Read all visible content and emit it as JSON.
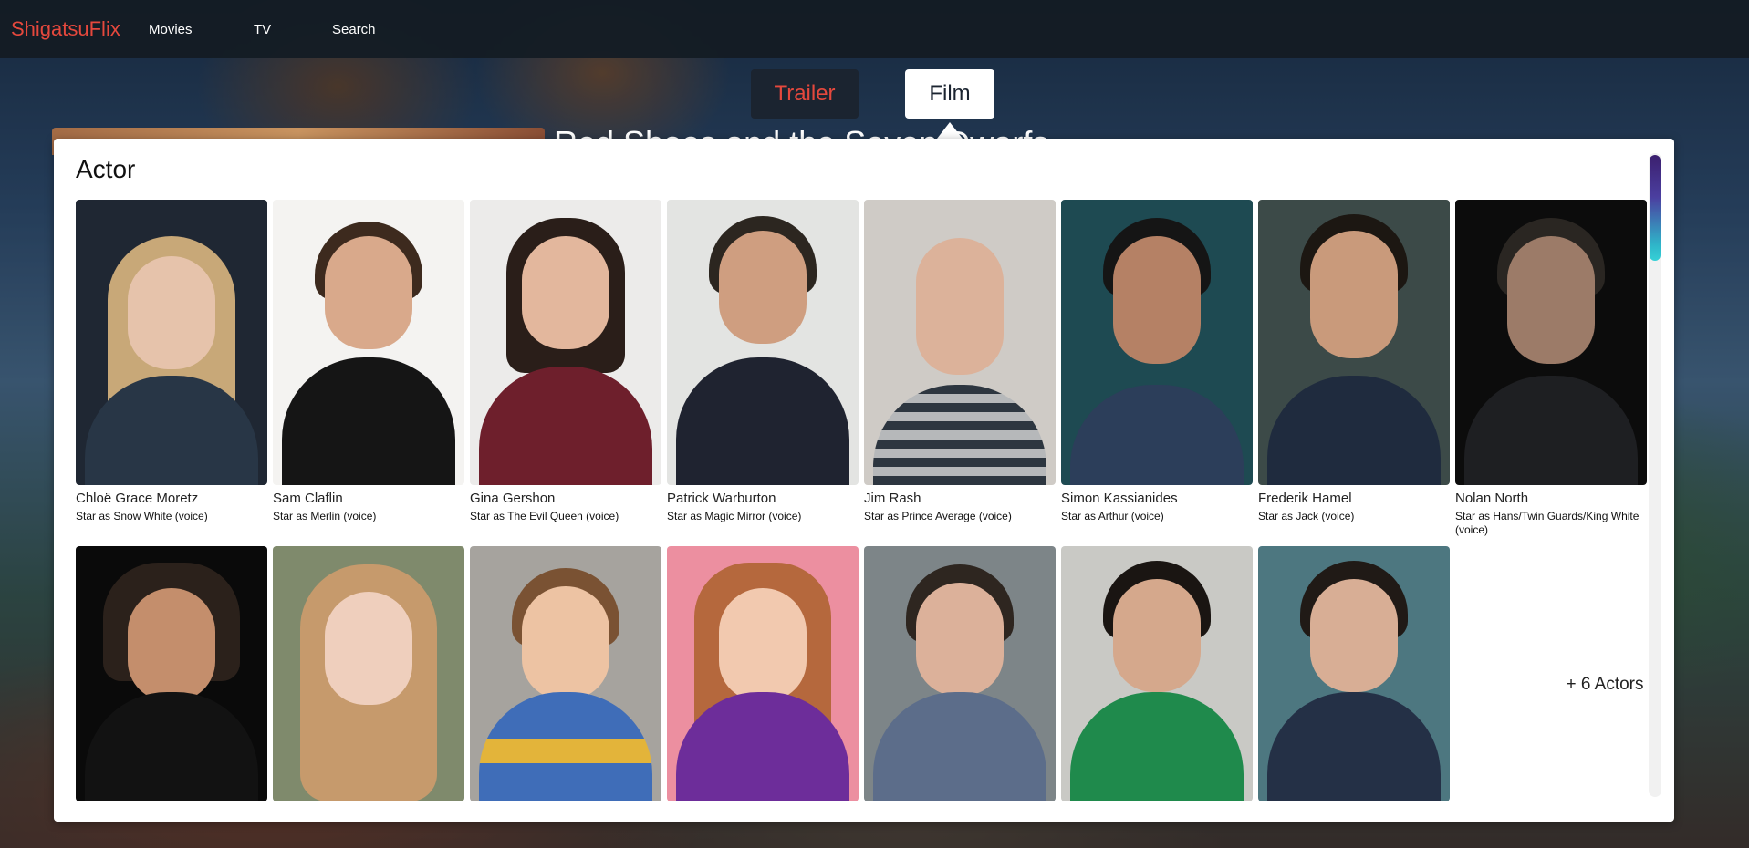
{
  "brand": "ShigatsuFlix",
  "nav": {
    "movies": "Movies",
    "tv": "TV",
    "search": "Search"
  },
  "tabs": {
    "trailer": "Trailer",
    "film": "Film"
  },
  "background_title": "Red Shoes and the Seven Dwarfs",
  "panel": {
    "heading": "Actor",
    "more_actors": "+ 6 Actors"
  },
  "actors": [
    {
      "name": "Chloë Grace Moretz",
      "role": "Star as Snow White (voice)"
    },
    {
      "name": "Sam Claflin",
      "role": "Star as Merlin (voice)"
    },
    {
      "name": "Gina Gershon",
      "role": "Star as The Evil Queen (voice)"
    },
    {
      "name": "Patrick Warburton",
      "role": "Star as Magic Mirror (voice)"
    },
    {
      "name": "Jim Rash",
      "role": "Star as Prince Average (voice)"
    },
    {
      "name": "Simon Kassianides",
      "role": "Star as Arthur (voice)"
    },
    {
      "name": "Frederik Hamel",
      "role": "Star as Jack (voice)"
    },
    {
      "name": "Nolan North",
      "role": "Star as Hans/Twin Guards/King White (voice)"
    }
  ],
  "colors": {
    "accent": "#e5483d",
    "navbar": "#141c24",
    "panel": "#ffffff"
  }
}
